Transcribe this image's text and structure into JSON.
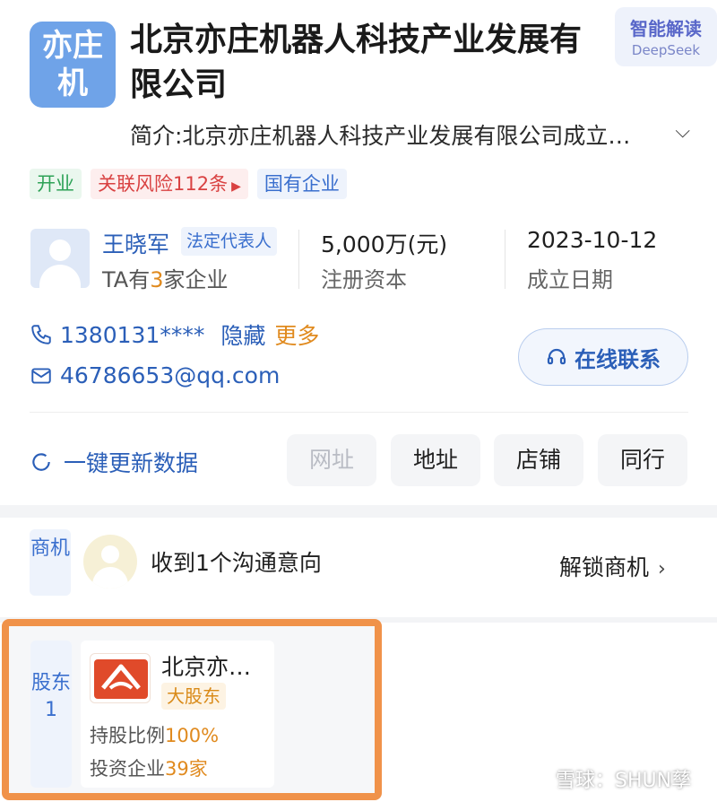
{
  "company": {
    "logo_text": "亦庄机",
    "title": "北京亦庄机器人科技产业发展有限公司",
    "intro": "简介:北京亦庄机器人科技产业发展有限公司成立…"
  },
  "ai_badge": {
    "line1": "智能解读",
    "line2": "DeepSeek"
  },
  "tags": {
    "status": "开业",
    "risk": "关联风险112条",
    "type": "国有企业"
  },
  "legal_rep": {
    "name": "王晓军",
    "role": "法定代表人",
    "count_prefix": "TA有",
    "count": "3",
    "count_suffix": "家企业"
  },
  "stats": {
    "capital_value": "5,000万(元)",
    "capital_label": "注册资本",
    "date_value": "2023-10-12",
    "date_label": "成立日期"
  },
  "contact": {
    "phone": "1380131****",
    "hide_label": "隐藏",
    "more_label": "更多",
    "email": "46786653@qq.com",
    "online_button": "在线联系"
  },
  "actions": {
    "refresh_label": "一键更新数据",
    "pills": [
      "网址",
      "地址",
      "店铺",
      "同行"
    ]
  },
  "opportunity": {
    "label": "商机",
    "text": "收到1个沟通意向",
    "unlock": "解锁商机"
  },
  "shareholder": {
    "label": "股东1",
    "name": "北京亦…",
    "badge": "大股东",
    "ratio_label": "持股比例",
    "ratio_value": "100%",
    "invest_label": "投资企业",
    "invest_value": "39家"
  },
  "watermark": "雪球：SHUN孳",
  "colors": {
    "accent_blue": "#2b5fb8",
    "highlight_orange": "#f0924a",
    "logo_blue": "#6fa3e8"
  }
}
